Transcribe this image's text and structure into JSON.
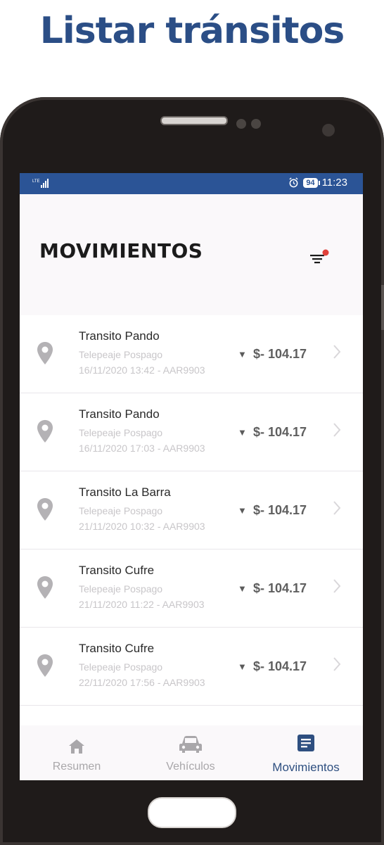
{
  "headline": "Listar tránsitos",
  "statusbar": {
    "battery": "94",
    "time": "11:23"
  },
  "header": {
    "title": "MOVIMIENTOS"
  },
  "transactions": [
    {
      "name": "Transito Pando",
      "type": "Telepeaje Pospago",
      "meta": "16/11/2020 13:42 - AAR9903",
      "amount": "$- 104.17"
    },
    {
      "name": "Transito Pando",
      "type": "Telepeaje Pospago",
      "meta": "16/11/2020 17:03 - AAR9903",
      "amount": "$- 104.17"
    },
    {
      "name": "Transito La Barra",
      "type": "Telepeaje Pospago",
      "meta": "21/11/2020 10:32 - AAR9903",
      "amount": "$- 104.17"
    },
    {
      "name": "Transito Cufre",
      "type": "Telepeaje Pospago",
      "meta": "21/11/2020 11:22 - AAR9903",
      "amount": "$- 104.17"
    },
    {
      "name": "Transito Cufre",
      "type": "Telepeaje Pospago",
      "meta": "22/11/2020 17:56 - AAR9903",
      "amount": "$- 104.17"
    }
  ],
  "tabs": [
    {
      "label": "Resumen",
      "icon": "home-icon"
    },
    {
      "label": "Vehículos",
      "icon": "car-icon"
    },
    {
      "label": "Movimientos",
      "icon": "document-icon",
      "active": true
    }
  ],
  "colors": {
    "brand": "#2b4e86",
    "statusbar": "#2b5496",
    "filter_dot": "#e0413a"
  }
}
